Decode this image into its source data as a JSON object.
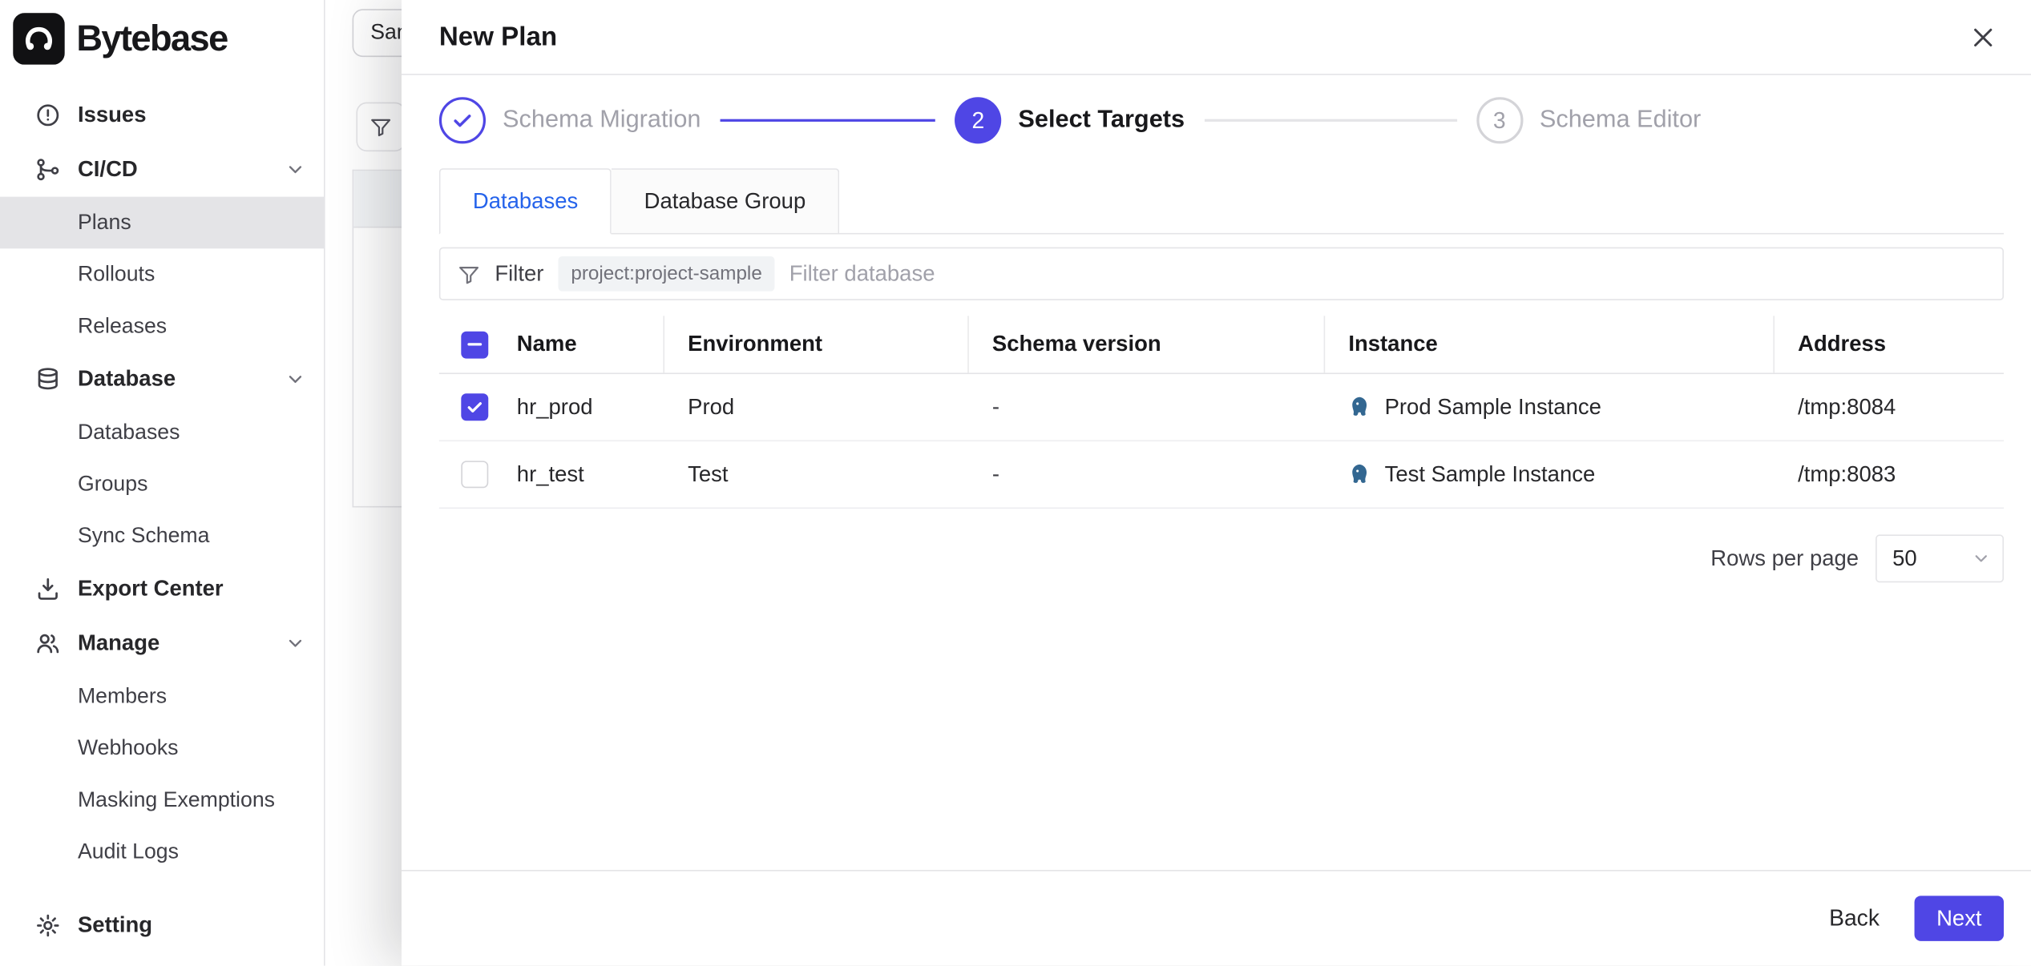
{
  "app": {
    "name": "Bytebase"
  },
  "colors": {
    "accent": "#4f46e5",
    "tab_active_text": "#2563eb",
    "postgres_logo": "#336791",
    "muted_text": "#a1a1aa",
    "sidebar_active_bg": "#e4e4e7"
  },
  "icons": {
    "logo": "bytebase-logo",
    "sidebar": [
      "issues-icon",
      "pipeline-icon",
      "database-icon",
      "export-icon",
      "users-icon",
      "gear-icon",
      "chevron-down-icon"
    ],
    "modal": [
      "close-icon",
      "check-icon",
      "funnel-icon",
      "postgres-icon",
      "chevron-down-icon"
    ]
  },
  "sidebar": {
    "items": [
      {
        "label": "Issues"
      },
      {
        "label": "CI/CD"
      },
      {
        "label": "Plans"
      },
      {
        "label": "Rollouts"
      },
      {
        "label": "Releases"
      },
      {
        "label": "Database"
      },
      {
        "label": "Databases"
      },
      {
        "label": "Groups"
      },
      {
        "label": "Sync Schema"
      },
      {
        "label": "Export Center"
      },
      {
        "label": "Manage"
      },
      {
        "label": "Members"
      },
      {
        "label": "Webhooks"
      },
      {
        "label": "Masking Exemptions"
      },
      {
        "label": "Audit Logs"
      },
      {
        "label": "Setting"
      }
    ]
  },
  "underlay": {
    "project_chip": "San"
  },
  "modal": {
    "title": "New Plan",
    "steps": [
      {
        "label": "Schema Migration",
        "state": "done"
      },
      {
        "number": "2",
        "label": "Select Targets",
        "state": "current"
      },
      {
        "number": "3",
        "label": "Schema Editor",
        "state": "upcoming"
      }
    ],
    "tabs": [
      {
        "label": "Databases",
        "active": true
      },
      {
        "label": "Database Group",
        "active": false
      }
    ],
    "filter": {
      "label": "Filter",
      "scope_chip": "project:project-sample",
      "placeholder": "Filter database"
    },
    "table": {
      "columns": [
        "Name",
        "Environment",
        "Schema version",
        "Instance",
        "Address"
      ],
      "rows": [
        {
          "checked": true,
          "name": "hr_prod",
          "environment": "Prod",
          "schema_version": "-",
          "instance": "Prod Sample Instance",
          "address": "/tmp:8084"
        },
        {
          "checked": false,
          "name": "hr_test",
          "environment": "Test",
          "schema_version": "-",
          "instance": "Test Sample Instance",
          "address": "/tmp:8083"
        }
      ]
    },
    "pagination": {
      "label": "Rows per page",
      "page_size": "50"
    },
    "footer": {
      "back_label": "Back",
      "next_label": "Next"
    }
  }
}
